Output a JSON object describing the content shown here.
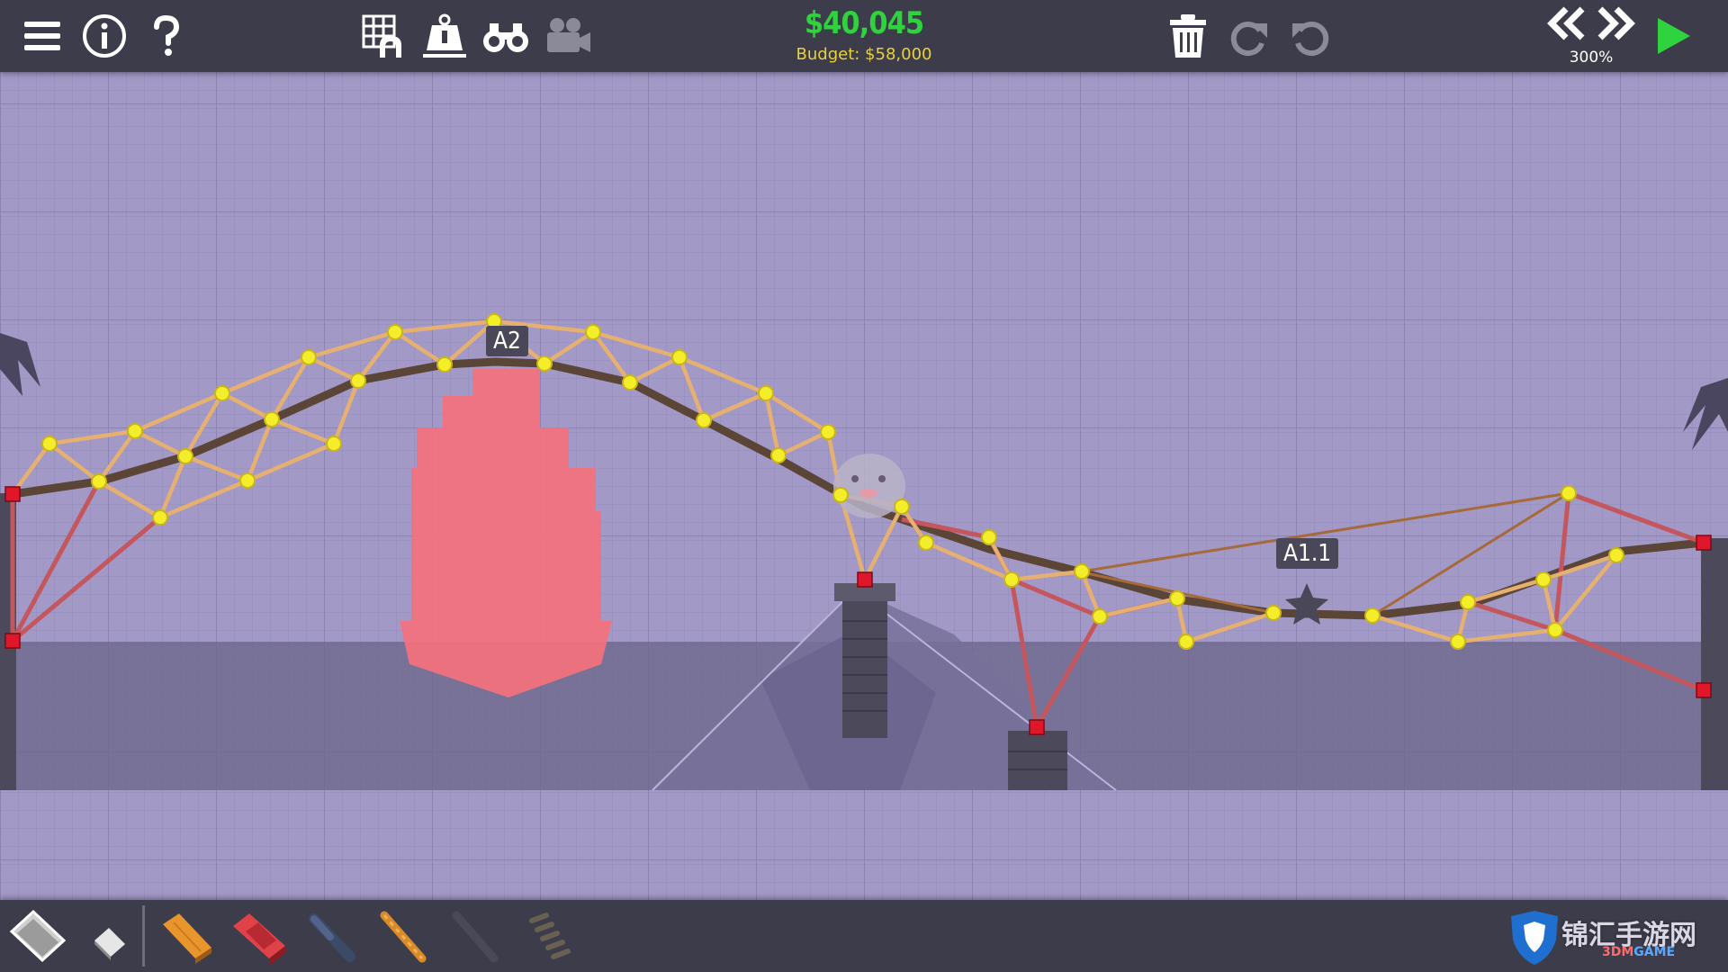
{
  "toolbar": {
    "left": [
      {
        "name": "menu-icon"
      },
      {
        "name": "info-icon"
      },
      {
        "name": "help-icon"
      }
    ],
    "center": [
      {
        "name": "grid-arch-icon"
      },
      {
        "name": "weight-icon"
      },
      {
        "name": "binoculars-icon"
      },
      {
        "name": "camera-icon"
      }
    ],
    "cost": "$40,045",
    "budget": "Budget: $58,000",
    "right": [
      {
        "name": "trash-icon"
      },
      {
        "name": "redo-icon"
      },
      {
        "name": "undo-icon"
      }
    ],
    "speed_label": "300%"
  },
  "labels": {
    "boat_checkpoint": "A2",
    "vehicle_checkpoint": "A1.1"
  },
  "materials": [
    {
      "name": "road-material-icon",
      "color": "#c9c9c9"
    },
    {
      "name": "eraser-icon",
      "color": "#e0e0e0"
    },
    {
      "name": "wood-material-icon",
      "color": "#e8952c"
    },
    {
      "name": "steel-material-icon",
      "color": "#d9383c"
    },
    {
      "name": "hydraulic-material-icon",
      "color": "#3b4a66"
    },
    {
      "name": "rope-material-icon",
      "color": "#d98b2a"
    },
    {
      "name": "cable-material-icon",
      "color": "#4a4a56"
    },
    {
      "name": "spring-material-icon",
      "color": "#6a6052"
    }
  ],
  "watermark": {
    "text": "锦汇手游网",
    "sub_a": "3DM",
    "sub_b": "GAME"
  },
  "colors": {
    "background": "#a299c6",
    "wood": "#e6b071",
    "road": "#5a4537",
    "steel": "#c4565e",
    "rope": "#a66a3a",
    "joint": "#f4ee2a",
    "anchor": "#e0162b",
    "boat": "#f5717d",
    "cost": "#2fd33d",
    "budget": "#e8d13a"
  }
}
